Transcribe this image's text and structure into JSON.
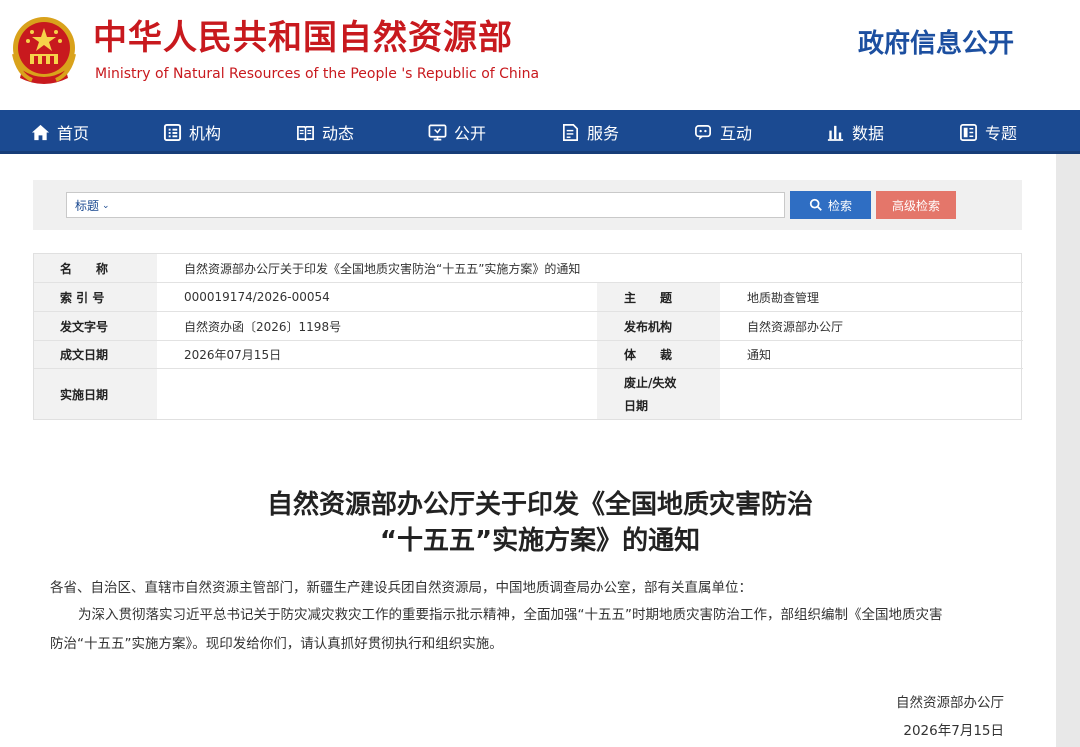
{
  "header": {
    "title_cn": "中华人民共和国自然资源部",
    "title_en": "Ministry of Natural Resources of the People 's Republic of China",
    "gov_info_link": "政府信息公开"
  },
  "nav": {
    "items": [
      {
        "label": "首页",
        "icon": "home-icon"
      },
      {
        "label": "机构",
        "icon": "institution-icon"
      },
      {
        "label": "动态",
        "icon": "news-icon"
      },
      {
        "label": "公开",
        "icon": "disclosure-icon"
      },
      {
        "label": "服务",
        "icon": "service-icon"
      },
      {
        "label": "互动",
        "icon": "chat-icon"
      },
      {
        "label": "数据",
        "icon": "bar-chart-icon"
      },
      {
        "label": "专题",
        "icon": "topic-icon"
      }
    ]
  },
  "search": {
    "field_selector": "标题",
    "query": "",
    "search_button": "检索",
    "advanced_button": "高级检索"
  },
  "meta": {
    "name_label": "名　　称",
    "name_value": "自然资源部办公厅关于印发《全国地质灾害防治“十五五”实施方案》的通知",
    "index_label": "索 引 号",
    "index_value": "000019174/2026-00054",
    "subject_label": "主　　题",
    "subject_value": "地质勘查管理",
    "doc_no_label": "发文字号",
    "doc_no_value": "自然资办函〔2026〕1198号",
    "issuer_label": "发布机构",
    "issuer_value": "自然资源部办公厅",
    "date_label": "成文日期",
    "date_value": "2026年07月15日",
    "genre_label": "体　　裁",
    "genre_value": "通知",
    "effective_label": "实施日期",
    "effective_value": "",
    "expiry_label_line1": "废止/失效",
    "expiry_label_line2": "日期",
    "expiry_value": ""
  },
  "article": {
    "title_line1": "自然资源部办公厅关于印发《全国地质灾害防治",
    "title_line2": "“十五五”实施方案》的通知",
    "salutation": "各省、自治区、直辖市自然资源主管部门，新疆生产建设兵团自然资源局，中国地质调查局办公室，部有关直属单位：",
    "body_line1": "为深入贯彻落实习近平总书记关于防灾减灾救灾工作的重要指示批示精神，全面加强“十五五”时期地质灾害防治工作，部组织编制《全国地质灾害",
    "body_line2": "防治“十五五”实施方案》。现印发给你们，请认真抓好贯彻执行和组织实施。",
    "signer": "自然资源部办公厅",
    "sign_date": "2026年7月15日"
  },
  "colors": {
    "brand_red": "#c8191e",
    "nav_blue": "#1b4a91",
    "search_blue": "#2f6ec3",
    "advanced_red": "#e4766a"
  }
}
